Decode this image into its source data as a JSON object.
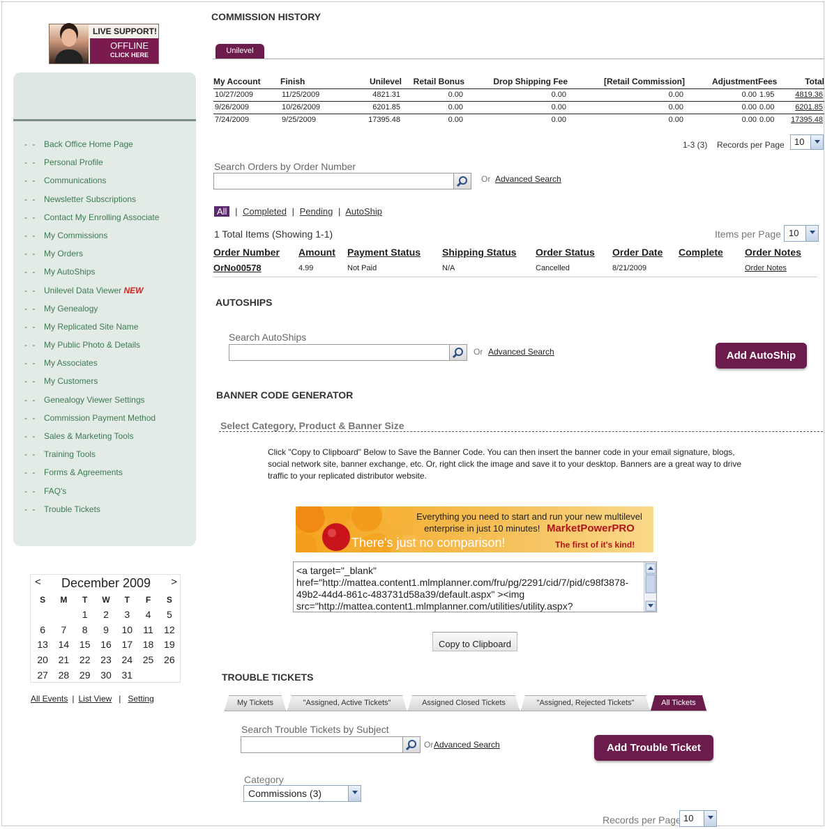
{
  "live_support": {
    "title": "LIVE SUPPORT!",
    "status": "OFFLINE",
    "cta": "CLICK HERE"
  },
  "sidebar": {
    "items": [
      {
        "label": "Back Office Home Page"
      },
      {
        "label": "Personal Profile"
      },
      {
        "label": "Communications"
      },
      {
        "label": "Newsletter Subscriptions"
      },
      {
        "label": "Contact My Enrolling Associate"
      },
      {
        "label": "My Commissions"
      },
      {
        "label": "My Orders"
      },
      {
        "label": "My AutoShips"
      },
      {
        "label": "Unilevel Data Viewer",
        "badge": "NEW"
      },
      {
        "label": "My Genealogy"
      },
      {
        "label": "My Replicated Site Name"
      },
      {
        "label": "My Public Photo & Details"
      },
      {
        "label": "My Associates"
      },
      {
        "label": "My Customers"
      },
      {
        "label": "Genealogy Viewer Settings"
      },
      {
        "label": "Commission Payment Method"
      },
      {
        "label": "Sales & Marketing Tools"
      },
      {
        "label": "Training Tools"
      },
      {
        "label": "Forms & Agreements"
      },
      {
        "label": "FAQ's"
      },
      {
        "label": "Trouble Tickets"
      }
    ],
    "bullet": "- -"
  },
  "calendar": {
    "prev": "<",
    "next": ">",
    "title": "December 2009",
    "weekdays": [
      "S",
      "M",
      "T",
      "W",
      "T",
      "F",
      "S"
    ],
    "weeks": [
      [
        "",
        "",
        "1",
        "2",
        "3",
        "4",
        "5"
      ],
      [
        "6",
        "7",
        "8",
        "9",
        "10",
        "11",
        "12"
      ],
      [
        "13",
        "14",
        "15",
        "16",
        "17",
        "18",
        "19"
      ],
      [
        "20",
        "21",
        "22",
        "23",
        "24",
        "25",
        "26"
      ],
      [
        "27",
        "28",
        "29",
        "30",
        "31",
        "",
        ""
      ]
    ],
    "links": {
      "all_events": "All Events",
      "list_view": "List View",
      "setting": "Setting",
      "sep": "|"
    }
  },
  "commission": {
    "title": "COMMISSION HISTORY",
    "tab": "Unilevel",
    "columns": [
      "My Account",
      "Finish",
      "Unilevel",
      "Retail Bonus",
      "Drop Shipping Fee",
      "[Retail Commission]",
      "Adjustment",
      "Fees",
      "Total"
    ],
    "rows": [
      [
        "10/27/2009",
        "11/25/2009",
        "4821.31",
        "0.00",
        "0.00",
        "0.00",
        "0.00",
        "1.95",
        "4819.36"
      ],
      [
        "9/26/2009",
        "10/26/2009",
        "6201.85",
        "0.00",
        "0.00",
        "0.00",
        "0.00",
        "0.00",
        "6201.85"
      ],
      [
        "7/24/2009",
        "9/25/2009",
        "17395.48",
        "0.00",
        "0.00",
        "0.00",
        "0.00",
        "0.00",
        "17395.48"
      ]
    ],
    "pager": "1-3 (3)",
    "records_label": "Records per Page",
    "records_value": "10"
  },
  "orders": {
    "search_label": "Search Orders by Order Number",
    "or": "Or",
    "advanced": "Advanced Search",
    "filters": {
      "all": "All",
      "completed": "Completed",
      "pending": "Pending",
      "autoship": "AutoShip",
      "sep": "|"
    },
    "total_label": "1 Total Items (Showing  1-1)",
    "items_per_page_label": "Items per Page",
    "items_per_page": "10",
    "columns": [
      "Order Number",
      "Amount",
      "Payment Status",
      "Shipping Status",
      "Order Status",
      "Order Date",
      "Complete",
      "Order Notes"
    ],
    "rows": [
      [
        "OrNo00578",
        "4.99",
        "Not Paid",
        "N/A",
        "Cancelled",
        "8/21/2009",
        "",
        "Order Notes"
      ]
    ]
  },
  "autoships": {
    "title": "AUTOSHIPS",
    "search_label": "Search AutoShips",
    "or": "Or",
    "advanced": "Advanced Search",
    "add_button": "Add AutoShip"
  },
  "banner_gen": {
    "title": "BANNER CODE GENERATOR",
    "select_label": "Select Category, Product & Banner Size",
    "instructions": "Click \"Copy to Clipboard\" Below to Save the Banner Code. You can then insert the banner code in your email signature, blogs, social network site, banner exchange, etc. Or, right click the image and save it to your desktop. Banners are a great way to drive traffic to your replicated distributor website.",
    "banner": {
      "line1": "Everything you need to start and run your new multilevel",
      "line2": "enterprise in just 10 minutes!",
      "brand": "MarketPowerPRO",
      "tagline": "There's just no comparison!",
      "sub": "The first of it's kind!"
    },
    "code": "<a target=\"_blank\" href=\"http://mattea.content1.mlmplanner.com/fru/pg/2291/cid/7/pid/c98f3878-49b2-44d4-861c-483731d58a39/default.aspx\" ><img src=\"http://mattea.content1.mlmplanner.com/utilities/utility.aspx?",
    "copy_button": "Copy to Clipboard"
  },
  "tickets": {
    "title": "TROUBLE TICKETS",
    "tabs": [
      "My Tickets",
      "\"Assigned, Active Tickets\"",
      "Assigned Closed Tickets",
      "\"Assigned, Rejected Tickets\"",
      "All Tickets"
    ],
    "search_label": "Search Trouble Tickets by Subject",
    "or": "Or",
    "advanced": "Advanced Search",
    "add_button": "Add Trouble Ticket",
    "category_label": "Category",
    "category_value": "Commissions (3)",
    "records_label": "Records per Page",
    "records_value": "10"
  },
  "colors": {
    "accent": "#6b1b4c",
    "nav_text": "#3c7a52",
    "sidebar_bg": "#e3ebe6"
  }
}
